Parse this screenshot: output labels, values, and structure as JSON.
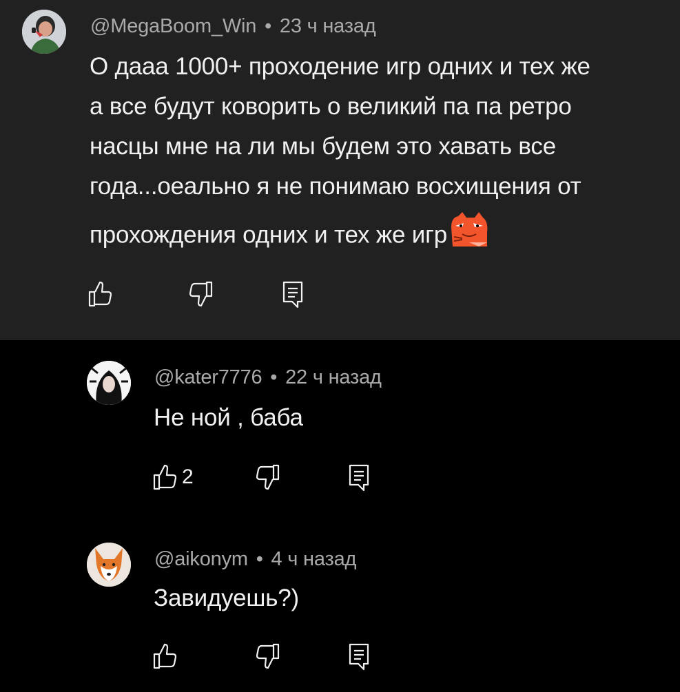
{
  "comments": [
    {
      "author": "@MegaBoom_Win",
      "separator": "•",
      "time": "23 ч назад",
      "lines": [
        "О дааа 1000+ проходение игр одних и тех же",
        "а все будут коворить о великий па па ретро",
        "насцы мне на ли мы будем это хавать все",
        "года...оеально я не понимаю восхищения от",
        "прохождения одних и тех же игр"
      ],
      "like_count": "",
      "avatar_icon": "person-with-microphone-avatar",
      "emoji_icon": "orange-cat-emoji"
    },
    {
      "author": "@kater7776",
      "separator": "•",
      "time": "22 ч назад",
      "lines": [
        "Не ной , баба"
      ],
      "like_count": "2",
      "avatar_icon": "dark-hair-girl-avatar"
    },
    {
      "author": "@aikonym",
      "separator": "•",
      "time": "4 ч назад",
      "lines": [
        "Завидуешь?)"
      ],
      "like_count": "",
      "avatar_icon": "fox-avatar"
    }
  ],
  "colors": {
    "highlight_bg": "#212121",
    "page_bg": "#000000",
    "text": "#f1f1f1",
    "meta": "#aaaaaa"
  }
}
